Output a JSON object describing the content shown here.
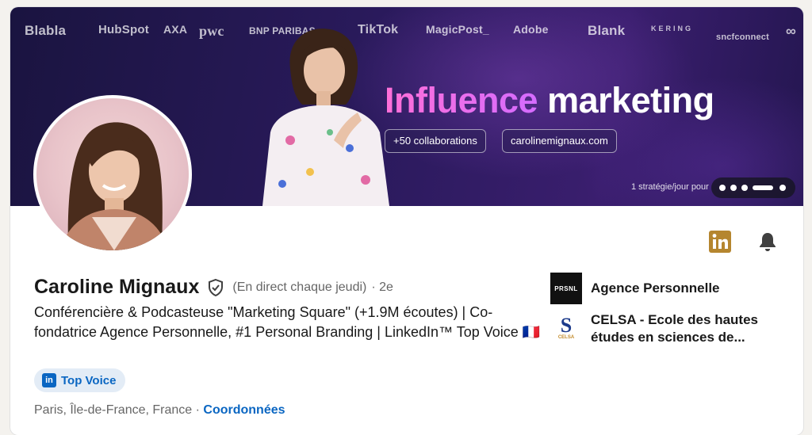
{
  "banner": {
    "brand_logos": [
      "Blabla",
      "HubSpot",
      "AXA",
      "pwc",
      "BNP PARIBAS",
      "TikTok",
      "MagicPost_",
      "Adobe",
      "Blank",
      "KERING",
      "sncfconnect",
      "∞"
    ],
    "headline_part1": "Influence",
    "headline_part2": "marketing",
    "pill_collabs": "+50 collaborations",
    "pill_site": "carolinemignaux.com",
    "caption": "1 stratégie/jour pour"
  },
  "profile": {
    "name": "Caroline Mignaux",
    "status": "(En direct chaque jeudi)",
    "degree": "· 2e",
    "headline": "Conférencière & Podcasteuse \"Marketing Square\" (+1.9M écoutes) | Co-fondatrice Agence Personnelle, #1 Personal Branding | LinkedIn™ Top Voice 🇫🇷",
    "badge_label": "Top Voice",
    "badge_icon": "in",
    "location": "Paris, Île-de-France, France",
    "location_separator": " · ",
    "contact_link": "Coordonnées"
  },
  "actions": {
    "linkedin_icon_text": "in"
  },
  "experience": {
    "company_1": {
      "logo_text": "PRSNL",
      "name": "Agence Personnelle"
    },
    "company_2": {
      "logo_text": "CELSA",
      "name": "CELSA - Ecole des hautes études en sciences de..."
    }
  },
  "colors": {
    "accent": "#0a66c2",
    "linkedin_gold": "#b5862f",
    "text_primary": "#191919",
    "text_secondary": "#666666",
    "badge_bg": "#e3ecf6"
  }
}
